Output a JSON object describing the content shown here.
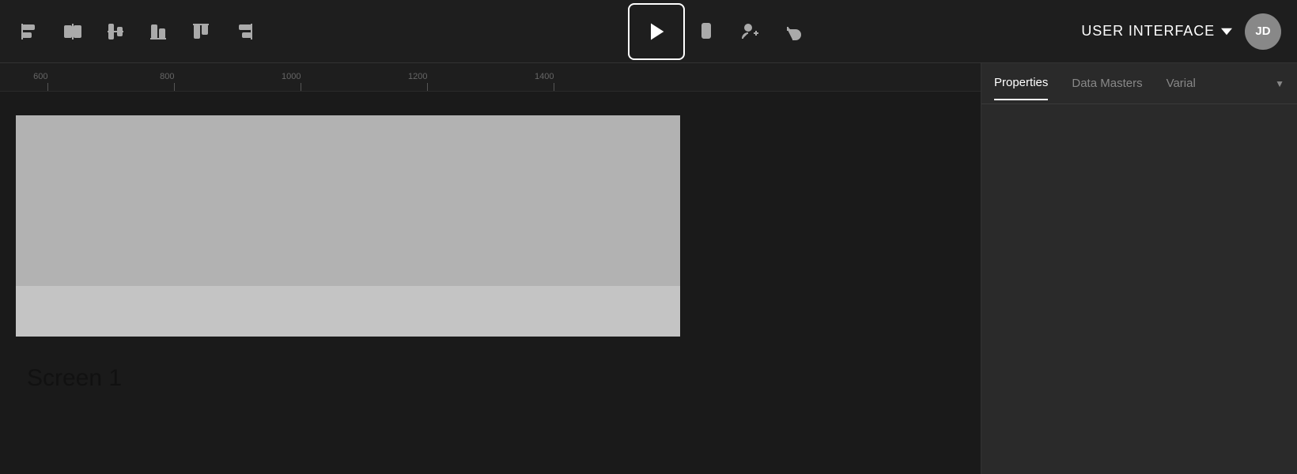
{
  "toolbar": {
    "play_label": "▶",
    "project_name": "USER INTERFACE",
    "dropdown_icon": "▼",
    "avatar_initials": "JD",
    "tools": [
      {
        "name": "align-left-icon",
        "label": "Align Left"
      },
      {
        "name": "align-columns-icon",
        "label": "Align Columns"
      },
      {
        "name": "align-center-v-icon",
        "label": "Align Center Vertical"
      },
      {
        "name": "align-bottom-icon",
        "label": "Align Bottom"
      },
      {
        "name": "align-top-icon",
        "label": "Align Top"
      },
      {
        "name": "align-right-icon",
        "label": "Align Right"
      }
    ],
    "right_tools": [
      {
        "name": "device-icon",
        "label": "Device Preview"
      },
      {
        "name": "add-user-icon",
        "label": "Add User"
      },
      {
        "name": "undo-icon",
        "label": "Undo"
      }
    ]
  },
  "panel": {
    "tabs": [
      {
        "label": "Properties",
        "active": true
      },
      {
        "label": "Data Masters",
        "active": false
      },
      {
        "label": "Varial",
        "active": false
      }
    ]
  },
  "ruler": {
    "marks": [
      {
        "value": "600",
        "pos": 60
      },
      {
        "value": "800",
        "pos": 220
      },
      {
        "value": "1000",
        "pos": 380
      },
      {
        "value": "1200",
        "pos": 540
      },
      {
        "value": "1400",
        "pos": 700
      }
    ]
  },
  "canvas": {
    "screen_label": "Screen 1"
  }
}
